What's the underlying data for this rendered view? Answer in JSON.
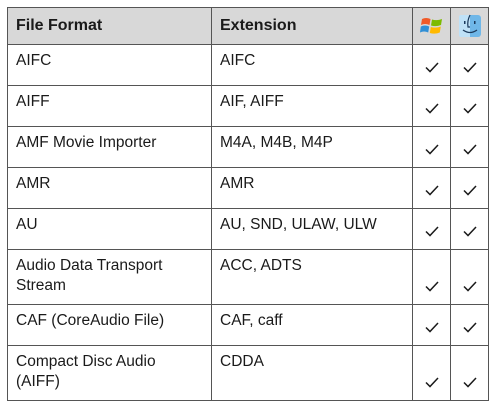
{
  "table": {
    "headers": {
      "format": "File Format",
      "extension": "Extension",
      "col3_icon": "windows-logo",
      "col4_icon": "mac-finder-logo"
    },
    "rows": [
      {
        "format": "AIFC",
        "extension": "AIFC",
        "windows": true,
        "mac": true
      },
      {
        "format": "AIFF",
        "extension": "AIF, AIFF",
        "windows": true,
        "mac": true
      },
      {
        "format": "AMF Movie Importer",
        "extension": "M4A, M4B, M4P",
        "windows": true,
        "mac": true
      },
      {
        "format": "AMR",
        "extension": "AMR",
        "windows": true,
        "mac": true
      },
      {
        "format": "AU",
        "extension": "AU, SND, ULAW, ULW",
        "windows": true,
        "mac": true
      },
      {
        "format": "Audio Data Transport Stream",
        "extension": "ACC, ADTS",
        "windows": true,
        "mac": true
      },
      {
        "format": "CAF (CoreAudio File)",
        "extension": "CAF, caff",
        "windows": true,
        "mac": true
      },
      {
        "format": "Compact Disc Audio (AIFF)",
        "extension": "CDDA",
        "windows": true,
        "mac": true
      }
    ]
  },
  "colors": {
    "header_bg": "#d8d8d8",
    "border": "#555555",
    "text": "#1a1a1a"
  }
}
